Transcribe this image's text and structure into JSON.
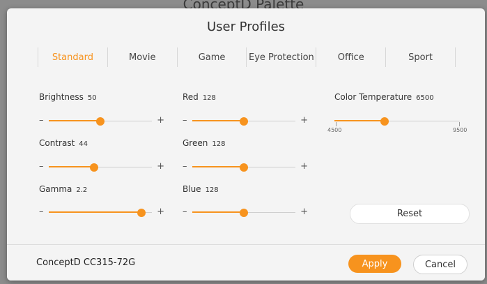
{
  "backdrop": {
    "title": "ConceptD Palette"
  },
  "dialog": {
    "title": "User Profiles",
    "tabs": [
      {
        "label": "Standard",
        "active": true
      },
      {
        "label": "Movie",
        "active": false
      },
      {
        "label": "Game",
        "active": false
      },
      {
        "label": "Eye Protection",
        "active": false
      },
      {
        "label": "Office",
        "active": false
      },
      {
        "label": "Sport",
        "active": false
      }
    ],
    "sliders": {
      "brightness": {
        "label": "Brightness",
        "value": "50",
        "position": 0.5
      },
      "contrast": {
        "label": "Contrast",
        "value": "44",
        "position": 0.44
      },
      "gamma": {
        "label": "Gamma",
        "value": "2.2",
        "position": 0.9
      },
      "red": {
        "label": "Red",
        "value": "128",
        "position": 0.5
      },
      "green": {
        "label": "Green",
        "value": "128",
        "position": 0.5
      },
      "blue": {
        "label": "Blue",
        "value": "128",
        "position": 0.5
      },
      "minus_symbol": "–",
      "plus_symbol": "+"
    },
    "color_temperature": {
      "label": "Color Temperature",
      "value": "6500",
      "min_label": "4500",
      "max_label": "9500",
      "position": 0.4
    },
    "reset_label": "Reset"
  },
  "footer": {
    "device_name": "ConceptD CC315-72G",
    "apply_label": "Apply",
    "cancel_label": "Cancel"
  },
  "colors": {
    "accent": "#f7931e",
    "dialog_bg": "#f4f4f4",
    "backdrop": "#8c8c8c"
  }
}
